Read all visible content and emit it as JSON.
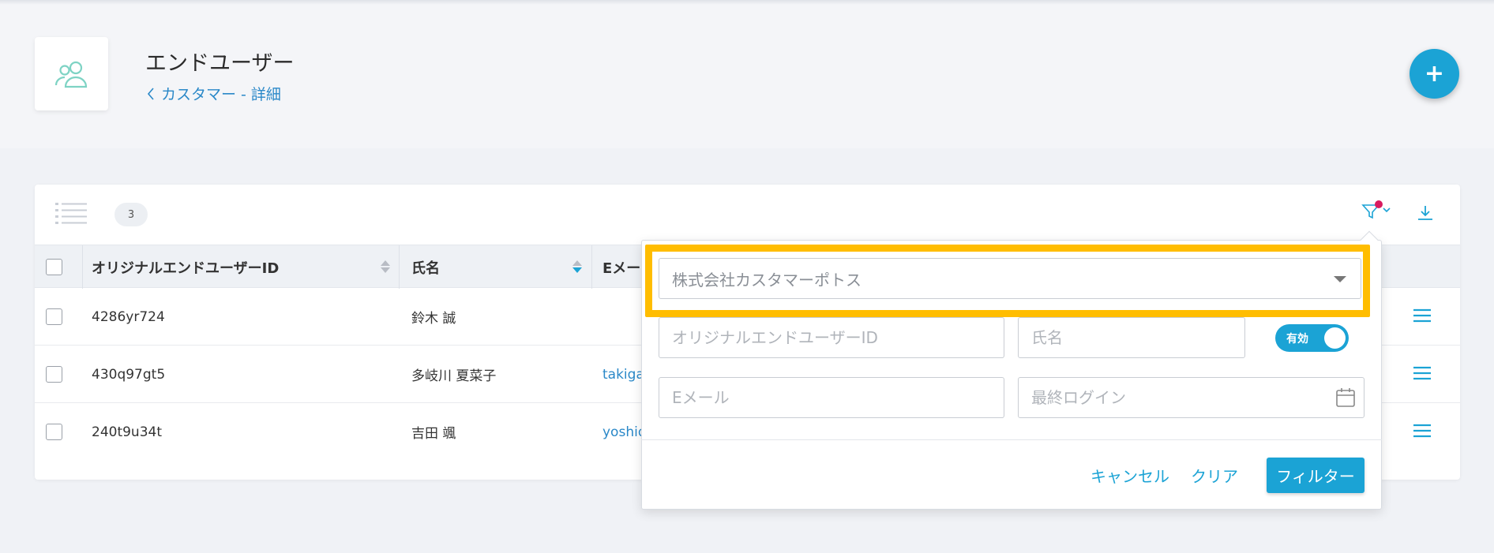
{
  "page": {
    "title": "エンドユーザー",
    "breadcrumb": "カスタマー - 詳細",
    "add_button": "+"
  },
  "toolbar": {
    "count": "3"
  },
  "table": {
    "columns": [
      "オリジナルエンドユーザーID",
      "氏名",
      "Eメー"
    ],
    "rows": [
      {
        "id": "4286yr724",
        "name": "鈴木 誠",
        "email": ""
      },
      {
        "id": "430q97gt5",
        "name": "多岐川 夏菜子",
        "email": "takiga"
      },
      {
        "id": "240t9u34t",
        "name": "吉田 颯",
        "email": "yoshid"
      }
    ]
  },
  "filter": {
    "company_select": "株式会社カスタマーポトス",
    "original_id_placeholder": "オリジナルエンドユーザーID",
    "name_placeholder": "氏名",
    "toggle_label": "有効",
    "email_placeholder": "Eメール",
    "last_login_placeholder": "最終ログイン",
    "cancel": "キャンセル",
    "clear": "クリア",
    "apply": "フィルター"
  },
  "colors": {
    "accent": "#1ba3d5",
    "link": "#2a88c8",
    "highlight": "#ffbd00",
    "badge_dot": "#d81b60"
  }
}
